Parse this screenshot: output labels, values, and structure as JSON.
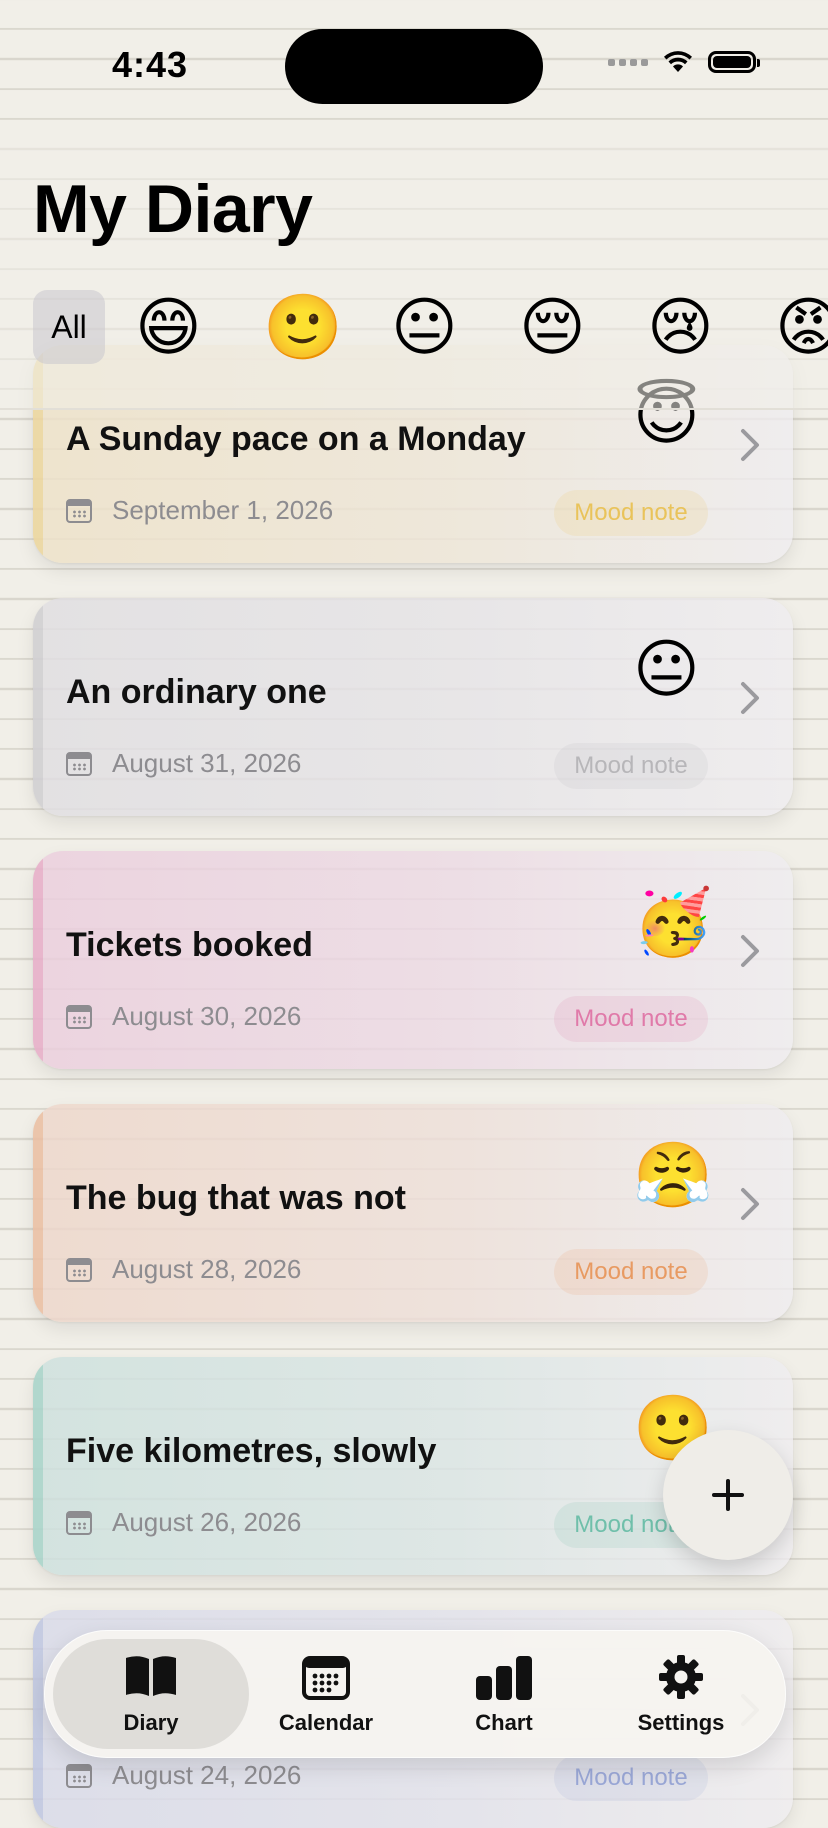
{
  "status_bar": {
    "time": "4:43"
  },
  "header": {
    "title": "My Diary"
  },
  "filters": {
    "all_label": "All",
    "moods": [
      "😄",
      "🙂",
      "😐",
      "😔",
      "😢",
      "😡"
    ]
  },
  "entries": [
    {
      "title": "A Sunday pace on a Monday",
      "date": "September 1, 2026",
      "emoji": "😇",
      "tag": "Mood note",
      "accent": "#e9c35a"
    },
    {
      "title": "An ordinary one",
      "date": "August 31, 2026",
      "emoji": "😐",
      "tag": "Mood note",
      "accent": "#b7b6b9"
    },
    {
      "title": "Tickets booked",
      "date": "August 30, 2026",
      "emoji": "🥳",
      "tag": "Mood note",
      "accent": "#e07aa9"
    },
    {
      "title": "The bug that was not",
      "date": "August 28, 2026",
      "emoji": "😤",
      "tag": "Mood note",
      "accent": "#e89a62"
    },
    {
      "title": "Five kilometres, slowly",
      "date": "August 26, 2026",
      "emoji": "🙂",
      "tag": "Mood note",
      "accent": "#6fbfaa"
    },
    {
      "title": "",
      "date": "August 24, 2026",
      "emoji": "",
      "tag": "Mood note",
      "accent": "#9aa7d6"
    }
  ],
  "tabs": [
    {
      "label": "Diary",
      "icon": "book-icon",
      "active": true
    },
    {
      "label": "Calendar",
      "icon": "calendar-icon",
      "active": false
    },
    {
      "label": "Chart",
      "icon": "chart-icon",
      "active": false
    },
    {
      "label": "Settings",
      "icon": "gear-icon",
      "active": false
    }
  ],
  "colors": {
    "accent": "#000000",
    "background": "#f1efe8"
  }
}
